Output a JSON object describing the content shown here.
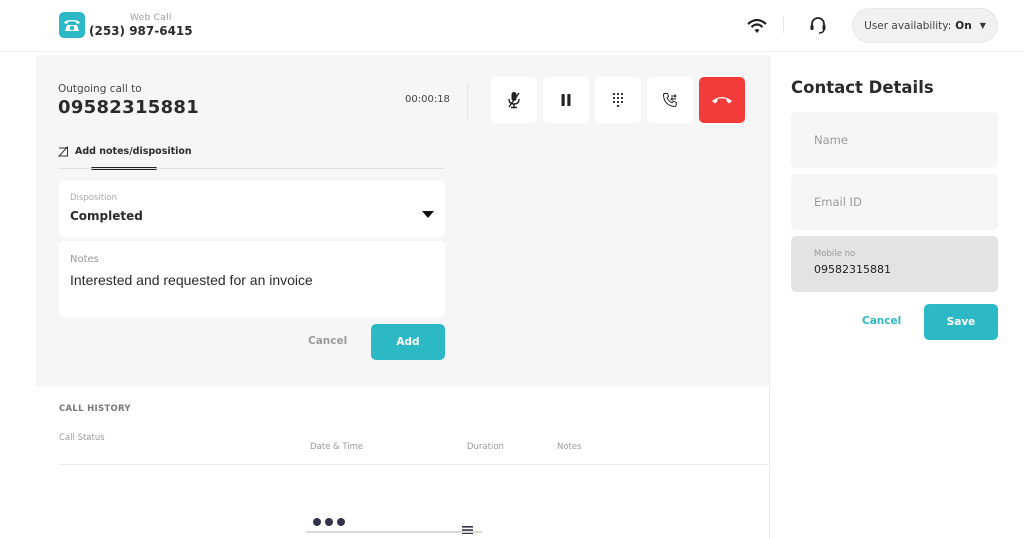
{
  "header": {
    "brand_subtitle": "Web Call",
    "brand_phone": "(253) 987-6415",
    "availability_label": "User availability:",
    "availability_value": "On",
    "icons": [
      "phone-logo-icon",
      "wifi-icon",
      "headset-icon",
      "caret-down-icon"
    ]
  },
  "call": {
    "label": "Outgoing call to",
    "number": "09582315881",
    "timer": "00:00:18",
    "controls": [
      {
        "name": "mute",
        "icon": "mic-off-icon"
      },
      {
        "name": "hold",
        "icon": "pause-icon"
      },
      {
        "name": "keypad",
        "icon": "dialpad-icon"
      },
      {
        "name": "transfer",
        "icon": "call-transfer-icon"
      },
      {
        "name": "end-call",
        "icon": "hang-up-icon"
      }
    ],
    "tab_label": "Add notes/disposition",
    "disposition_label": "Disposition",
    "disposition_value": "Completed",
    "notes_label": "Notes",
    "notes_value": "Interested and requested for an invoice",
    "cancel_label": "Cancel",
    "add_label": "Add"
  },
  "history": {
    "title": "CALL HISTORY",
    "columns": [
      "Call Status",
      "Date & Time",
      "Duration",
      "Notes"
    ],
    "rows": []
  },
  "contact": {
    "title": "Contact Details",
    "name_placeholder": "Name",
    "email_placeholder": "Email ID",
    "mobile_label": "Mobile no",
    "mobile_value": "09582315881",
    "cancel_label": "Cancel",
    "save_label": "Save"
  },
  "colors": {
    "accent": "#2db8c5",
    "end_call": "#f23b3b",
    "panel_bg": "#f6f6f6"
  }
}
